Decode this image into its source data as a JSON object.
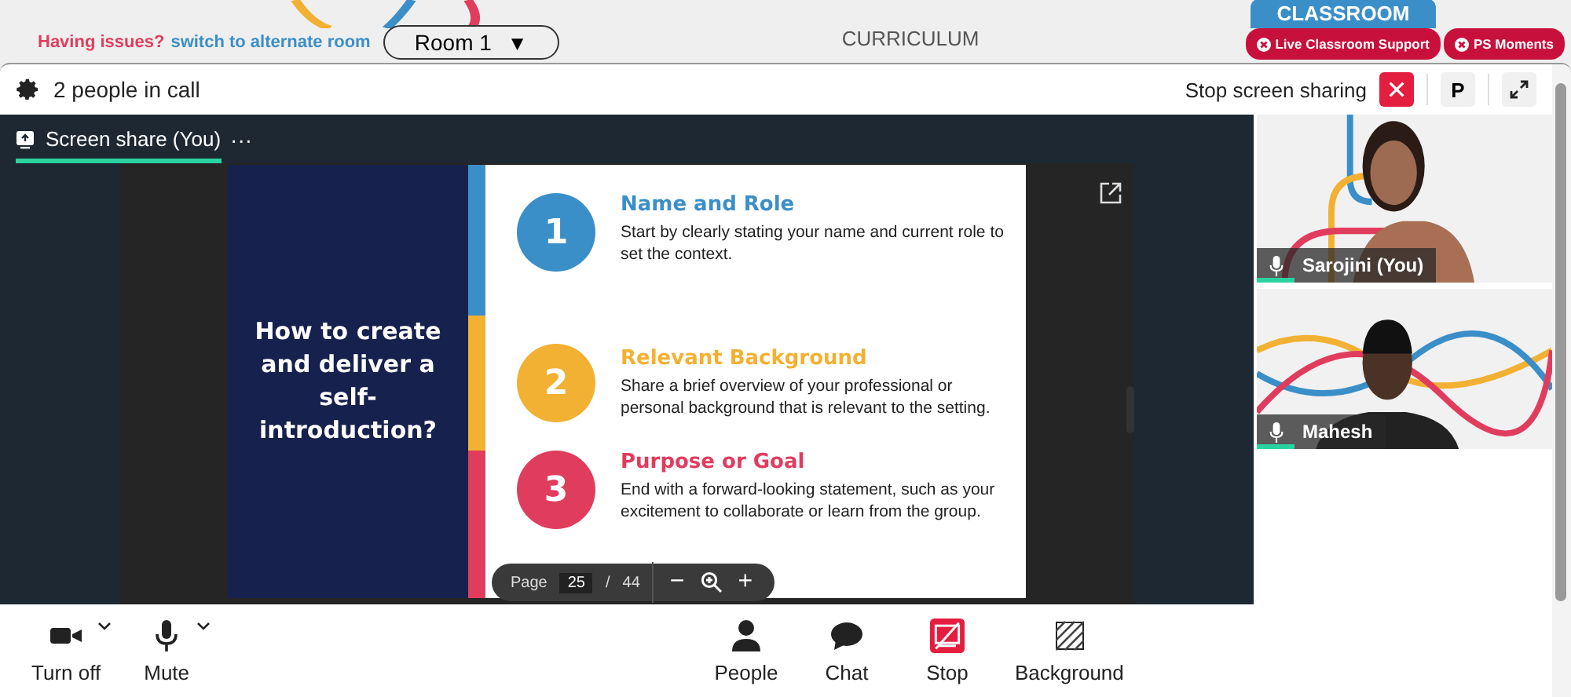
{
  "banner": {
    "issue_text": "Having issues?",
    "switch_link": "switch to alternate room",
    "room_select": "Room 1",
    "caret": "▼",
    "title": "CURRICULUM",
    "classroom_tab": "CLASSROOM",
    "buttons": [
      {
        "label": "Live Classroom Support"
      },
      {
        "label": "PS Moments"
      }
    ]
  },
  "call_header": {
    "people_count": "2 people in call",
    "stop_sharing_label": "Stop screen sharing",
    "presenter_button": "P"
  },
  "share_tab": {
    "label": "Screen share (You)",
    "menu": "···",
    "selected": true
  },
  "slide": {
    "title": "How to create and deliver a self-introduction?",
    "steps": [
      {
        "number": "1",
        "heading": "Name and Role",
        "text": "Start by clearly stating your name and current role to set the context.",
        "color": "#3b8fc8"
      },
      {
        "number": "2",
        "heading": "Relevant Background",
        "text": "Share a brief overview of your professional or personal background that is relevant to the setting.",
        "color": "#f2b132"
      },
      {
        "number": "3",
        "heading": "Purpose or Goal",
        "text": "End with a forward-looking statement, such as your excitement to collaborate or learn from the group.",
        "color": "#e03c5e"
      }
    ]
  },
  "pdf_toolbar": {
    "page_label": "Page",
    "page": "25",
    "separator": "/",
    "total": "44",
    "zoom_out": "−",
    "zoom_in": "+"
  },
  "participants": [
    {
      "name": "Sarojini (You)",
      "kind": "woman"
    },
    {
      "name": "Mahesh",
      "kind": "man"
    }
  ],
  "controls": [
    {
      "label": "Turn off",
      "kind": "camera",
      "dropdown": true
    },
    {
      "label": "Mute",
      "kind": "mic",
      "dropdown": true
    },
    {
      "label": "People",
      "kind": "people"
    },
    {
      "label": "Chat",
      "kind": "chat"
    },
    {
      "label": "Stop",
      "kind": "stop"
    },
    {
      "label": "Background",
      "kind": "background"
    }
  ]
}
